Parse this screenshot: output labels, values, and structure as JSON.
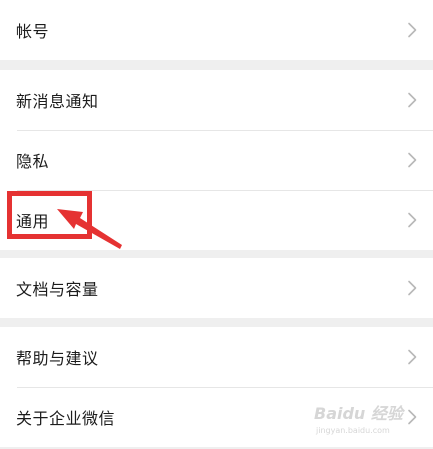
{
  "settings": {
    "groups": [
      {
        "items": [
          {
            "label": "帐号"
          }
        ]
      },
      {
        "items": [
          {
            "label": "新消息通知"
          },
          {
            "label": "隐私"
          },
          {
            "label": "通用"
          }
        ]
      },
      {
        "items": [
          {
            "label": "文档与容量"
          }
        ]
      },
      {
        "items": [
          {
            "label": "帮助与建议"
          },
          {
            "label": "关于企业微信"
          }
        ]
      }
    ]
  },
  "icons": {
    "chevron": "chevron-right-icon",
    "annotation_arrow": "arrow-icon"
  },
  "colors": {
    "background": "#efefef",
    "card": "#ffffff",
    "text": "#1c1c1c",
    "chevron": "#b8b8b8",
    "annotation": "#e53232"
  },
  "watermark": {
    "brand": "Baidu 经验",
    "url": "jingyan.baidu.com"
  }
}
